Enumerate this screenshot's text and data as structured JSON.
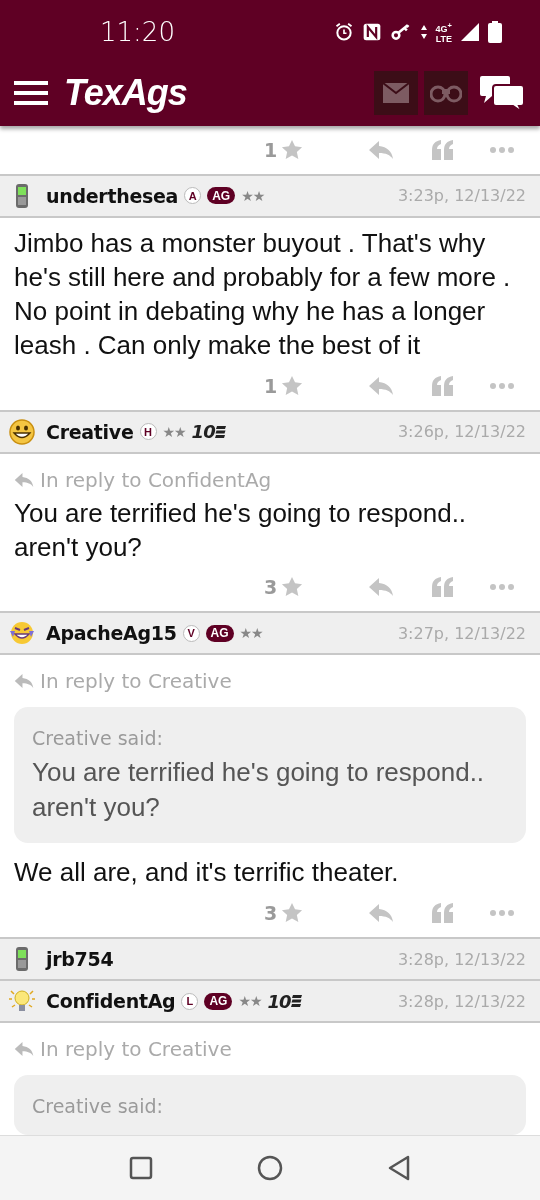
{
  "status_bar": {
    "time": "11:20",
    "network": "4G$^{+}$",
    "network_type": "LTE"
  },
  "app_bar": {
    "logo": "TexAgs"
  },
  "feed": [
    {
      "kind": "actions",
      "likes": "1"
    },
    {
      "kind": "post",
      "username": "underthesea",
      "badges": [
        {
          "text": "A",
          "kind": "outline"
        },
        {
          "text": "AG",
          "kind": "filled"
        }
      ],
      "rank": "★★",
      "time": "3:23p, 12/13/22",
      "body": "Jimbo has a monster buyout . That's why he's still here and probably for a few more . No point in debating why he has a longer leash . Can only make the best of it"
    },
    {
      "kind": "actions",
      "likes": "1"
    },
    {
      "kind": "post",
      "username": "Creative",
      "badges": [
        {
          "text": "H",
          "kind": "outline"
        }
      ],
      "rank": "★★",
      "tier": "10",
      "time": "3:26p, 12/13/22",
      "reply_to": "In reply to ConfidentAg",
      "body": "You are terrified he's going to respond.. aren't you?"
    },
    {
      "kind": "actions",
      "likes": "3"
    },
    {
      "kind": "post",
      "username": "ApacheAg15",
      "badges": [
        {
          "text": "V",
          "kind": "outline"
        },
        {
          "text": "AG",
          "kind": "filled"
        }
      ],
      "rank": "★★",
      "time": "3:27p, 12/13/22",
      "reply_to": "In reply to Creative",
      "quote": {
        "author": "Creative said:",
        "text": "You are terrified he's going to respond.. aren't you?"
      },
      "body": "We all are, and it's terrific theater."
    },
    {
      "kind": "actions",
      "likes": "3"
    },
    {
      "kind": "post",
      "username": "jrb754",
      "time": "3:28p, 12/13/22"
    },
    {
      "kind": "post",
      "username": "ConfidentAg",
      "badges": [
        {
          "text": "L",
          "kind": "outline"
        },
        {
          "text": "AG",
          "kind": "filled"
        }
      ],
      "rank": "★★",
      "tier": "10",
      "time": "3:28p, 12/13/22",
      "reply_to": "In reply to Creative",
      "quote": {
        "author": "Creative said:"
      }
    }
  ]
}
